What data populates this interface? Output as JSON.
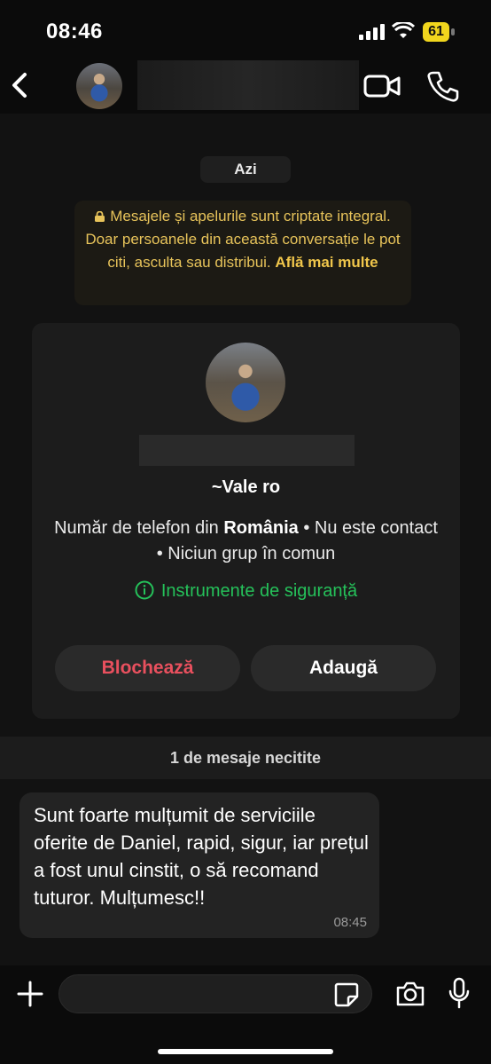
{
  "status_bar": {
    "time": "08:46",
    "battery": "61"
  },
  "chat_header": {
    "contact_name": "",
    "icons": [
      "back-chevron-icon",
      "video-call-icon",
      "voice-call-icon"
    ]
  },
  "chat": {
    "date_label": "Azi",
    "encryption_notice": {
      "text": "Mesajele și apelurile sunt criptate integral. Doar persoanele din această conversație le pot citi, asculta sau distribui.",
      "link": "Află mai multe"
    },
    "contact_card": {
      "name": "~Vale ro",
      "info_prefix": "Număr de telefon din",
      "info_country": "România",
      "info_suffix": "• Nu este contact • Niciun grup în comun",
      "safety_tools": "Instrumente de siguranță",
      "block_label": "Blochează",
      "add_label": "Adaugă"
    },
    "unread_label": "1 de mesaje necitite",
    "messages": [
      {
        "text": "Sunt foarte mulțumit de serviciile oferite de Daniel, rapid, sigur, iar prețul a fost unul cinstit, o să recomand tuturor. Mulțumesc!!",
        "time": "08:45"
      }
    ]
  },
  "composer": {
    "placeholder": ""
  },
  "colors": {
    "accent_green": "#25c15a",
    "block_red": "#e9505e",
    "encryption_text": "#e7c35a"
  }
}
